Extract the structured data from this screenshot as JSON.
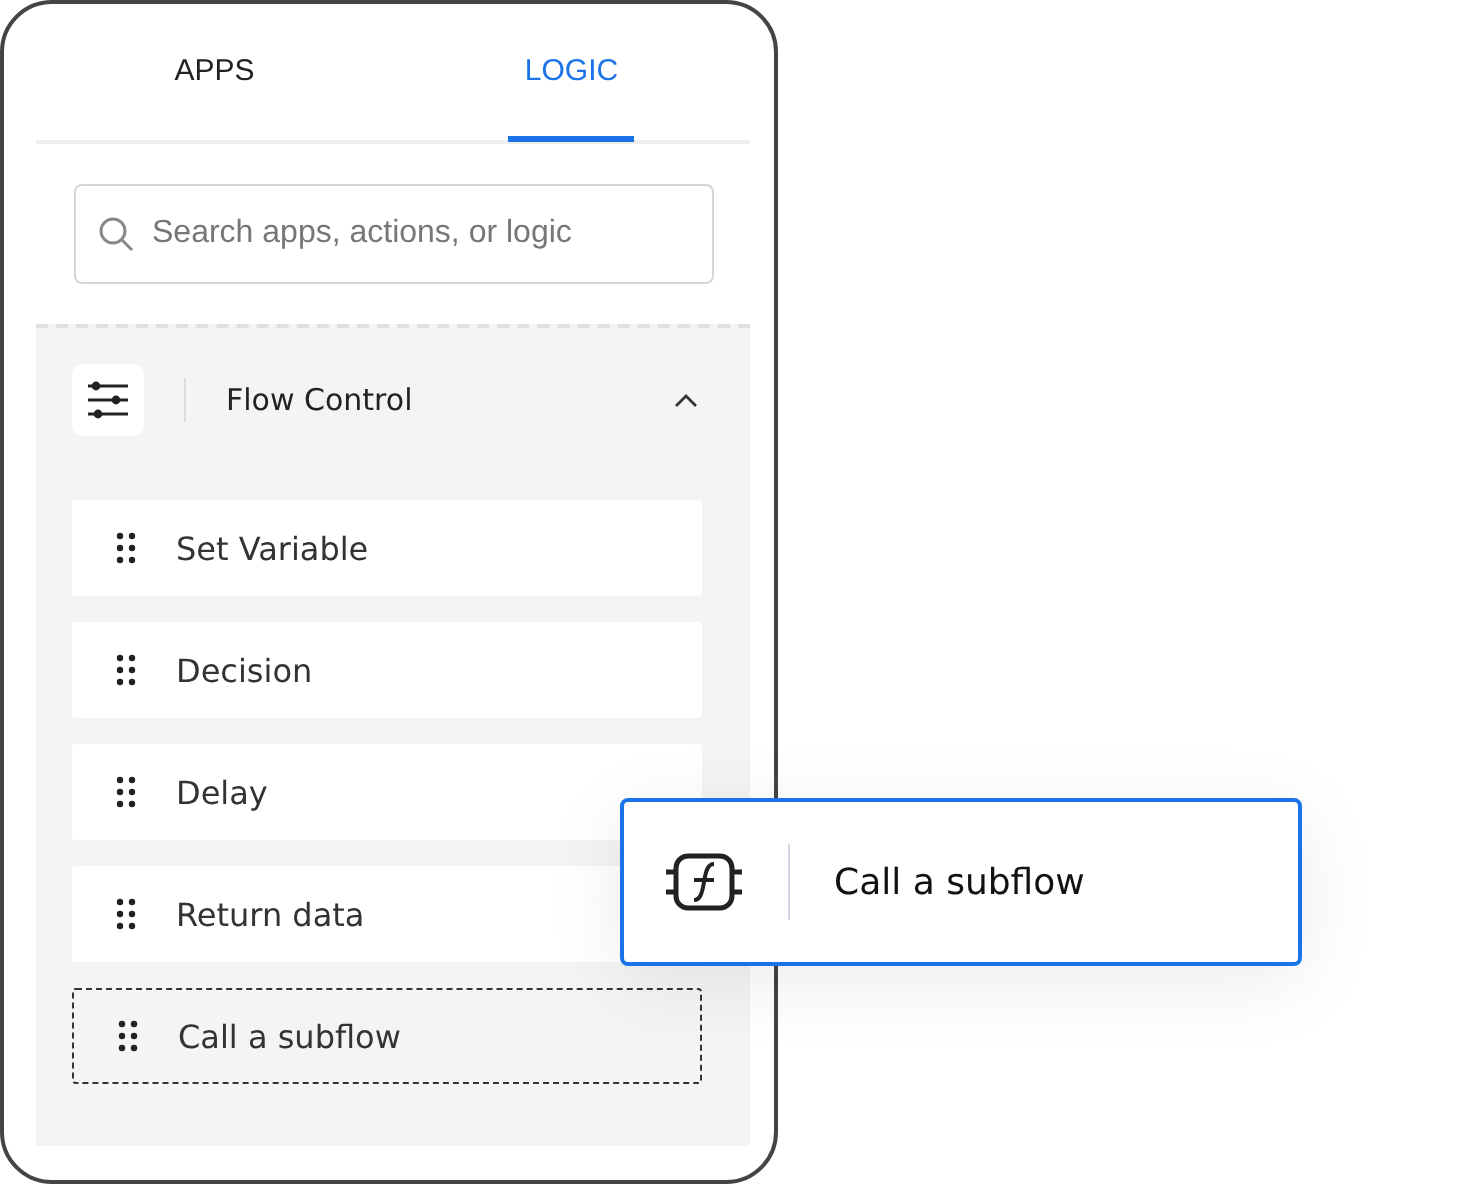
{
  "tabs": [
    {
      "label": "APPS",
      "selected": false
    },
    {
      "label": "LOGIC",
      "selected": true
    }
  ],
  "search": {
    "placeholder": "Search apps, actions, or logic"
  },
  "section": {
    "title": "Flow Control",
    "expanded": true
  },
  "items": [
    {
      "label": "Set Variable",
      "kind": "item"
    },
    {
      "label": "Decision",
      "kind": "item"
    },
    {
      "label": "Delay",
      "kind": "item"
    },
    {
      "label": "Return data",
      "kind": "item"
    },
    {
      "label": "Call a subflow",
      "kind": "drop-placeholder"
    }
  ],
  "drag_preview": {
    "label": "Call a subflow"
  }
}
